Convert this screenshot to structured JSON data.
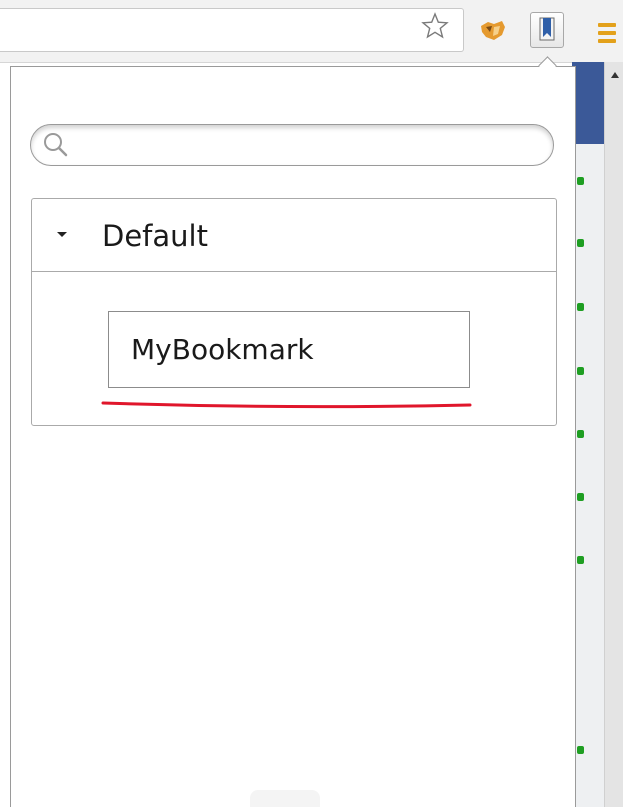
{
  "toolbar": {
    "omnibox_value": "",
    "icons": [
      "star-icon",
      "fox-extension-icon",
      "bookmark-extension-icon",
      "menu-icon"
    ]
  },
  "popup": {
    "search": {
      "value": "",
      "placeholder": ""
    },
    "folder": {
      "name": "Default",
      "expanded": true,
      "bookmarks": [
        {
          "label": "MyBookmark"
        }
      ]
    }
  },
  "colors": {
    "menu_icon": "#e3a11b",
    "page_blue": "#3b5998",
    "status_dots": "#1e9e22",
    "annotation_underline": "#e0162b"
  }
}
